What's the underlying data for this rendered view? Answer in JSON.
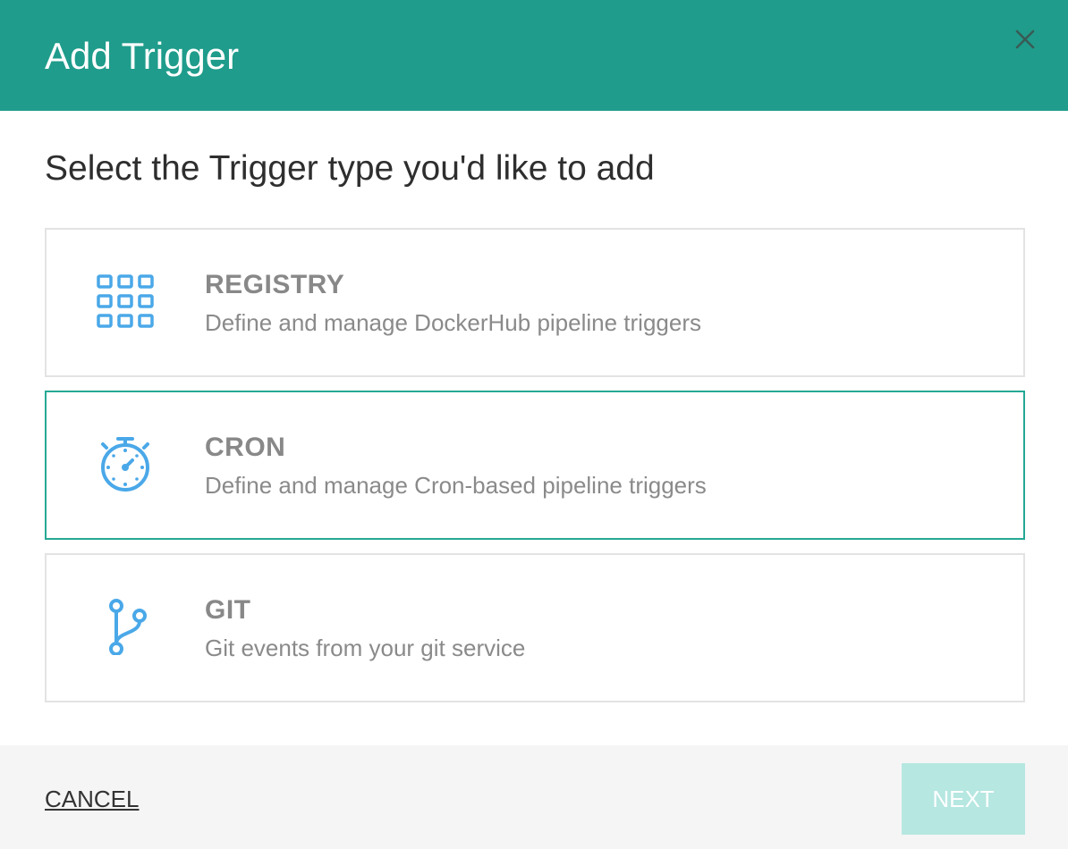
{
  "dialog": {
    "title": "Add Trigger",
    "close_icon": "close-icon",
    "subtitle": "Select the Trigger type you'd like to add"
  },
  "options": [
    {
      "name": "REGISTRY",
      "description": "Define and manage DockerHub pipeline triggers",
      "icon": "grid-icon",
      "selected": false
    },
    {
      "name": "CRON",
      "description": "Define and manage Cron-based pipeline triggers",
      "icon": "stopwatch-icon",
      "selected": true
    },
    {
      "name": "GIT",
      "description": "Git events from your git service",
      "icon": "git-branch-icon",
      "selected": false
    }
  ],
  "footer": {
    "cancel_label": "CANCEL",
    "next_label": "NEXT"
  },
  "colors": {
    "header": "#1f9c8b",
    "accent": "#26a894",
    "icon": "#4aa8e8",
    "next_disabled": "#b6e7e1"
  }
}
